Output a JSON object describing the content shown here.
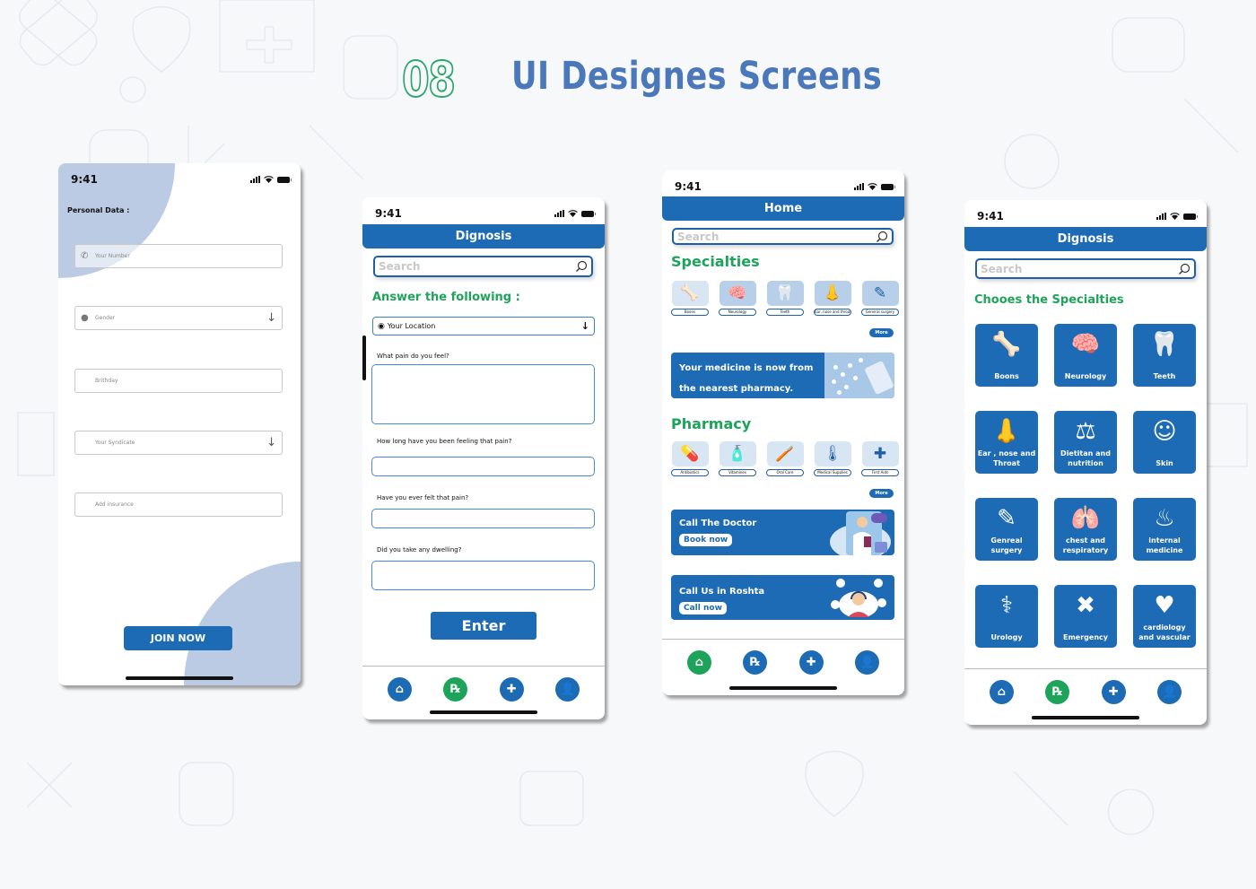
{
  "header": {
    "number": "08",
    "title": "UI Designes Screens"
  },
  "colors": {
    "primary": "#1e6bb5",
    "accent_green": "#1ea35a",
    "blob": "#bccbe4",
    "title_blue": "#4a78ba"
  },
  "status_bar": {
    "time": "9:41"
  },
  "screen_personal": {
    "section_label": "Personal Data :",
    "fields": [
      {
        "placeholder": "Your Number",
        "icon": "phone-icon"
      },
      {
        "placeholder": "Gender",
        "icon": "person-icon",
        "dropdown": true
      },
      {
        "placeholder": "Brithday"
      },
      {
        "placeholder": "Your Syndicate",
        "dropdown": true
      },
      {
        "placeholder": "Add insurance"
      }
    ],
    "button_label": "JOIN NOW"
  },
  "screen_diagnosis": {
    "appbar_title": "Dignosis",
    "search_placeholder": "Search",
    "heading": "Answer the following :",
    "location_select": "Your Location",
    "questions": [
      "What pain do you feel?",
      "How long have you been feeling that pain?",
      "Have you ever felt that pain?",
      "Did you take any dwelling?"
    ],
    "button_label": "Enter"
  },
  "screen_home": {
    "appbar_title": "Home",
    "search_placeholder": "Search",
    "specialties_heading": "Specialties",
    "specialties": [
      "Boons",
      "Neurology",
      "Teeth",
      "Ear, nose and throat",
      "General surgery"
    ],
    "more_label": "More",
    "medicine_banner": {
      "line1": "Your medicine is now from",
      "line2": "the nearest pharmacy."
    },
    "pharmacy_heading": "Pharmacy",
    "pharmacy_items": [
      "Antibiotics",
      "Vitamines",
      "Oral Care",
      "Medical Supplies",
      "First Aids"
    ],
    "pharmacy_more_label": "More",
    "doctor_banner": {
      "title": "Call The Doctor",
      "button": "Book now"
    },
    "call_banner": {
      "title": "Call Us in Roshta",
      "button": "Call now"
    }
  },
  "screen_specialties": {
    "appbar_title": "Dignosis",
    "search_placeholder": "Search",
    "heading": "Chooes the Specialties",
    "tiles": [
      {
        "label": "Boons",
        "icon": "bone-joint-icon"
      },
      {
        "label": "Neurology",
        "icon": "brain-icon"
      },
      {
        "label": "Teeth",
        "icon": "tooth-icon"
      },
      {
        "label": "Ear , nose and Throat",
        "icon": "nose-icon"
      },
      {
        "label": "Dietitan and nutrition",
        "icon": "scale-icon"
      },
      {
        "label": "Skin",
        "icon": "face-icon"
      },
      {
        "label": "Genreal surgery",
        "icon": "scalpel-icon"
      },
      {
        "label": "chest and respiratory",
        "icon": "lungs-icon"
      },
      {
        "label": "internal medicine",
        "icon": "stomach-icon"
      },
      {
        "label": "Urology",
        "icon": "kidney-icon"
      },
      {
        "label": "Emergency",
        "icon": "bandage-icon"
      },
      {
        "label": "cardiology and vascular",
        "icon": "heart-pulse-icon"
      }
    ]
  },
  "bottom_nav": {
    "items": [
      {
        "name": "home",
        "glyph": "⌂"
      },
      {
        "name": "prescription",
        "glyph": "℞"
      },
      {
        "name": "pharmacy",
        "glyph": "✚"
      },
      {
        "name": "profile",
        "glyph": "👤"
      }
    ]
  }
}
